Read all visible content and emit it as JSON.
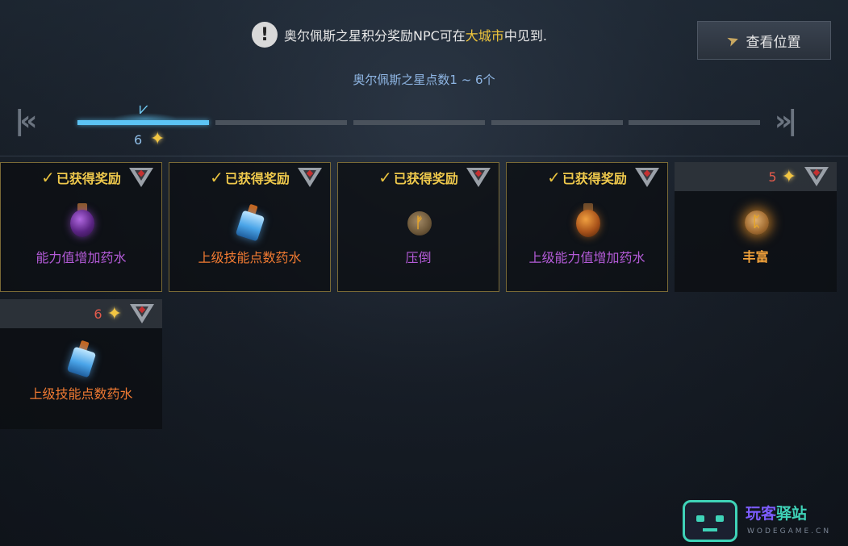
{
  "notice": {
    "text_before": "奥尔佩斯之星积分奖励NPC可在",
    "highlight": "大城市",
    "text_after": "中见到."
  },
  "location_button": {
    "label": "查看位置",
    "icon": "compass-icon"
  },
  "range_label": "奥尔佩斯之星点数1 ~ 6个",
  "progress": {
    "total_segments": 5,
    "active_segments": 1,
    "current_points": "6"
  },
  "rewards": [
    {
      "status_label": "已获得奖励",
      "name": "能力值增加药水",
      "item_icon": "purple-potion-icon",
      "name_color": "#b45bd8"
    },
    {
      "status_label": "已获得奖励",
      "name": "上级技能点数药水",
      "item_icon": "blue-potion-icon",
      "name_color": "#f07a32"
    },
    {
      "status_label": "已获得奖励",
      "name": "压倒",
      "item_icon": "rune-icon",
      "name_color": "#b45bd8"
    },
    {
      "status_label": "已获得奖励",
      "name": "上级能力值增加药水",
      "item_icon": "orange-potion-icon",
      "name_color": "#b45bd8"
    },
    {
      "cost": "5",
      "name": "丰富",
      "item_icon": "glowing-rune-icon",
      "name_color": "#f3a33a"
    },
    {
      "cost": "6",
      "name": "上级技能点数药水",
      "item_icon": "blue-potion-icon",
      "name_color": "#f07a32"
    }
  ],
  "watermark": {
    "brand_a": "玩客",
    "brand_b": "驿站",
    "sub": "WODEGAME.CN"
  },
  "colors": {
    "accent": "#5cc4f5",
    "gold": "#efc94c",
    "highlight": "#f0c63c"
  }
}
